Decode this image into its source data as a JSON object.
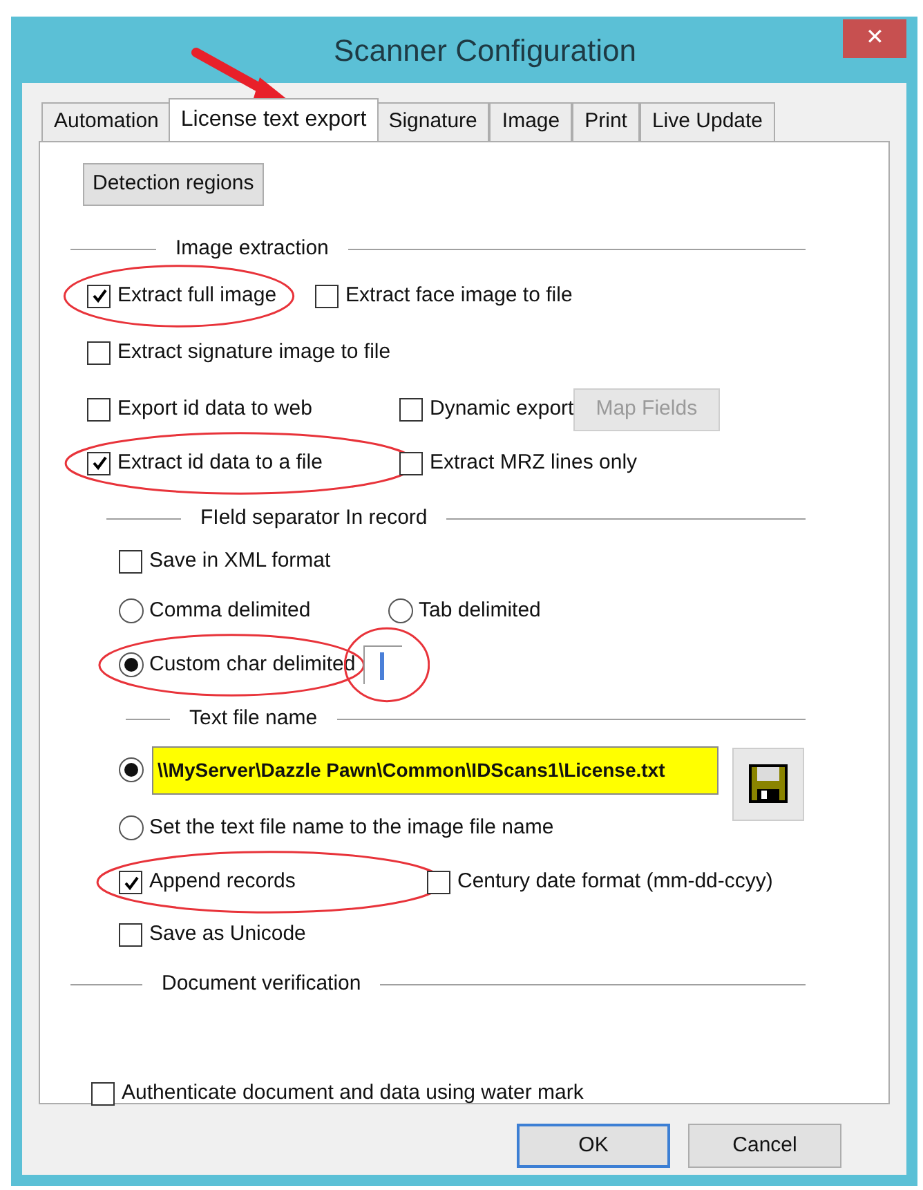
{
  "window": {
    "title": "Scanner Configuration",
    "close": "✕"
  },
  "tabs": [
    {
      "label": "Automation",
      "selected": false
    },
    {
      "label": "License text export",
      "selected": true
    },
    {
      "label": "Signature",
      "selected": false
    },
    {
      "label": "Image",
      "selected": false
    },
    {
      "label": "Print",
      "selected": false
    },
    {
      "label": "Live Update",
      "selected": false
    }
  ],
  "detection_button": "Detection regions",
  "sections": [
    {
      "title": "Image extraction",
      "rows": [
        [
          {
            "kind": "checkbox",
            "label": "Extract full image",
            "checked": true,
            "highlighted": true
          },
          {
            "kind": "checkbox",
            "label": "Extract face image to file",
            "checked": false,
            "highlighted": false
          }
        ],
        [
          {
            "kind": "checkbox",
            "label": "Extract signature image to file",
            "checked": false,
            "highlighted": false
          }
        ],
        [
          {
            "kind": "checkbox",
            "label": "Export id data to web",
            "checked": false,
            "highlighted": false
          },
          {
            "kind": "checkbox",
            "label": "Dynamic export",
            "checked": false,
            "highlighted": false
          },
          {
            "kind": "button",
            "label": "Map Fields",
            "disabled": true
          }
        ],
        [
          {
            "kind": "checkbox",
            "label": "Extract id data to a file",
            "checked": true,
            "highlighted": true
          },
          {
            "kind": "checkbox",
            "label": "Extract MRZ lines only",
            "checked": false,
            "highlighted": false
          }
        ]
      ]
    },
    {
      "title": "FIeld separator In record",
      "rows": [
        [
          {
            "kind": "checkbox",
            "label": "Save in XML format",
            "checked": false,
            "highlighted": false
          }
        ],
        [
          {
            "kind": "radio",
            "label": "Comma delimited",
            "selected": false,
            "highlighted": false
          },
          {
            "kind": "radio",
            "label": "Tab delimited",
            "selected": false,
            "highlighted": false
          }
        ],
        [
          {
            "kind": "radio",
            "label": "Custom char delimited",
            "selected": true,
            "highlighted": true
          },
          {
            "kind": "char_field",
            "highlighted": true
          }
        ]
      ]
    },
    {
      "title": "Text file name",
      "rows": [
        [
          {
            "kind": "path_radio",
            "value": "\\\\MyServer\\Dazzle Pawn\\Common\\IDScans1\\License.txt",
            "selected": true
          },
          {
            "kind": "save_button"
          }
        ],
        [
          {
            "kind": "radio",
            "label": "Set the text file name to the image file name",
            "selected": false,
            "highlighted": false
          }
        ],
        [
          {
            "kind": "checkbox",
            "label": "Append records",
            "checked": true,
            "highlighted": true
          },
          {
            "kind": "checkbox",
            "label": "Century date format (mm-dd-ccyy)",
            "checked": false,
            "highlighted": false
          }
        ],
        [
          {
            "kind": "checkbox",
            "label": "Save as Unicode",
            "checked": false,
            "highlighted": false
          }
        ]
      ]
    },
    {
      "title": "Document verification",
      "rows": [
        [
          {
            "kind": "checkbox",
            "label": "Authenticate document and data using water mark",
            "checked": false,
            "highlighted": false
          }
        ]
      ]
    }
  ],
  "buttons": [
    {
      "label": "OK",
      "selected": true
    },
    {
      "label": "Cancel",
      "selected": false
    }
  ]
}
